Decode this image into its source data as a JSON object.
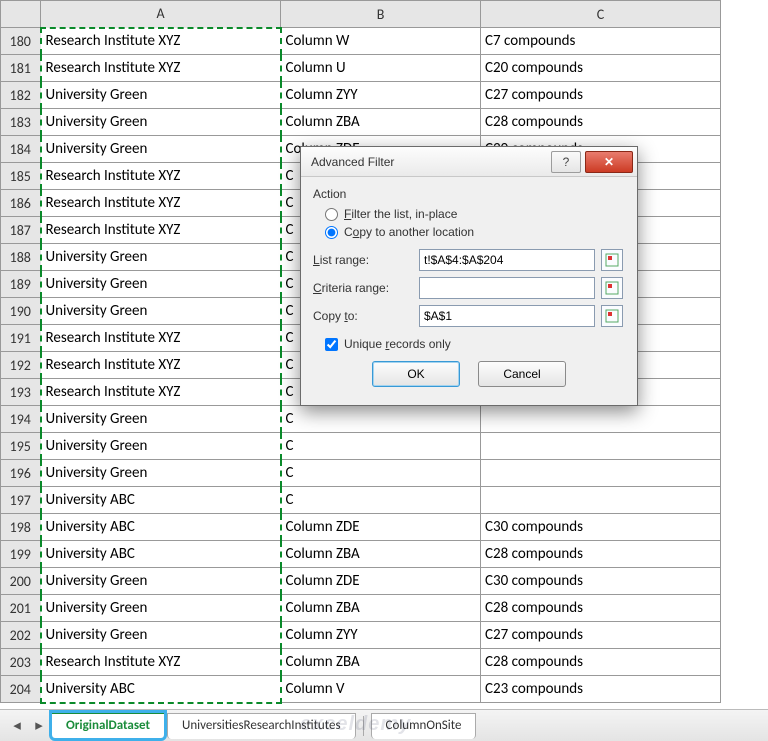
{
  "columns": [
    "A",
    "B",
    "C"
  ],
  "rows": [
    {
      "n": 180,
      "a": "Research Institute XYZ",
      "b": "Column W",
      "c": "C7 compounds"
    },
    {
      "n": 181,
      "a": "Research Institute XYZ",
      "b": "Column U",
      "c": "C20 compounds"
    },
    {
      "n": 182,
      "a": "University Green",
      "b": "Column ZYY",
      "c": "C27 compounds"
    },
    {
      "n": 183,
      "a": "University Green",
      "b": "Column ZBA",
      "c": "C28 compounds"
    },
    {
      "n": 184,
      "a": "University Green",
      "b": "Column ZDE",
      "c": "C30 compounds"
    },
    {
      "n": 185,
      "a": "Research Institute XYZ",
      "b": "C",
      "c": ""
    },
    {
      "n": 186,
      "a": "Research Institute XYZ",
      "b": "C",
      "c": ""
    },
    {
      "n": 187,
      "a": "Research Institute XYZ",
      "b": "C",
      "c": ""
    },
    {
      "n": 188,
      "a": "University Green",
      "b": "C",
      "c": ""
    },
    {
      "n": 189,
      "a": "University Green",
      "b": "C",
      "c": ""
    },
    {
      "n": 190,
      "a": "University Green",
      "b": "C",
      "c": ""
    },
    {
      "n": 191,
      "a": "Research Institute XYZ",
      "b": "C",
      "c": ""
    },
    {
      "n": 192,
      "a": "Research Institute XYZ",
      "b": "C",
      "c": ""
    },
    {
      "n": 193,
      "a": "Research Institute XYZ",
      "b": "C",
      "c": ""
    },
    {
      "n": 194,
      "a": "University Green",
      "b": "C",
      "c": ""
    },
    {
      "n": 195,
      "a": "University Green",
      "b": "C",
      "c": ""
    },
    {
      "n": 196,
      "a": "University Green",
      "b": "C",
      "c": ""
    },
    {
      "n": 197,
      "a": "University ABC",
      "b": "C",
      "c": ""
    },
    {
      "n": 198,
      "a": "University ABC",
      "b": "Column ZDE",
      "c": "C30 compounds"
    },
    {
      "n": 199,
      "a": "University ABC",
      "b": "Column ZBA",
      "c": "C28 compounds"
    },
    {
      "n": 200,
      "a": "University Green",
      "b": "Column ZDE",
      "c": "C30 compounds"
    },
    {
      "n": 201,
      "a": "University Green",
      "b": "Column ZBA",
      "c": "C28 compounds"
    },
    {
      "n": 202,
      "a": "University Green",
      "b": "Column ZYY",
      "c": "C27 compounds"
    },
    {
      "n": 203,
      "a": "Research Institute XYZ",
      "b": "Column ZBA",
      "c": "C28 compounds"
    },
    {
      "n": 204,
      "a": "University ABC",
      "b": "Column V",
      "c": "C23 compounds"
    }
  ],
  "tabs": {
    "active": "OriginalDataset",
    "others": [
      "UniversitiesResearchInstitutes",
      "ColumnOnSite"
    ]
  },
  "dialog": {
    "title": "Advanced Filter",
    "action_label": "Action",
    "radio_filter": "Filter the list, in-place",
    "radio_copy": "Copy to another location",
    "radio_selected": "copy",
    "list_range_label": "List range:",
    "list_range_value": "t!$A$4:$A$204",
    "criteria_range_label": "Criteria range:",
    "criteria_range_value": "",
    "copy_to_label": "Copy to:",
    "copy_to_value": "$A$1",
    "unique_label": "Unique records only",
    "unique_checked": true,
    "ok": "OK",
    "cancel": "Cancel"
  },
  "watermark": "exceldemy"
}
